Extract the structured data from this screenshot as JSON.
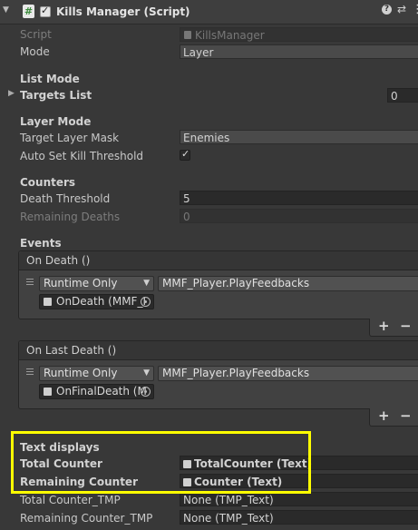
{
  "header": {
    "title": "Kills Manager (Script)",
    "help_glyph": "?",
    "settings_glyph": "⇄",
    "menu_glyph": "⋮"
  },
  "props": {
    "script_label": "Script",
    "script_value": "KillsManager",
    "mode_label": "Mode",
    "mode_value": "Layer"
  },
  "list_mode": {
    "heading": "List Mode",
    "targets_label": "Targets List",
    "targets_count": "0"
  },
  "layer_mode": {
    "heading": "Layer Mode",
    "mask_label": "Target Layer Mask",
    "mask_value": "Enemies",
    "auto_label": "Auto Set Kill Threshold",
    "auto_checked": "✓"
  },
  "counters": {
    "heading": "Counters",
    "death_label": "Death Threshold",
    "death_value": "5",
    "remaining_label": "Remaining Deaths",
    "remaining_value": "0"
  },
  "events": {
    "heading": "Events",
    "on_death": {
      "title": "On Death ()",
      "runtime": "Runtime Only",
      "function": "MMF_Player.PlayFeedbacks",
      "target": "OnDeath (MMF_I"
    },
    "on_last_death": {
      "title": "On Last Death ()",
      "runtime": "Runtime Only",
      "function": "MMF_Player.PlayFeedbacks",
      "target": "OnFinalDeath (M"
    },
    "plus": "+",
    "minus": "−"
  },
  "text_displays": {
    "heading": "Text displays",
    "total_label": "Total Counter",
    "total_value": "TotalCounter (Text)",
    "remaining_label": "Remaining Counter",
    "remaining_value": "Counter (Text)",
    "total_tmp_label": "Total Counter_TMP",
    "total_tmp_value": "None (TMP_Text)",
    "remaining_tmp_label": "Remaining Counter_TMP",
    "remaining_tmp_value": "None (TMP_Text)"
  },
  "colors": {
    "highlight": "#ffff00",
    "background": "#383838"
  }
}
